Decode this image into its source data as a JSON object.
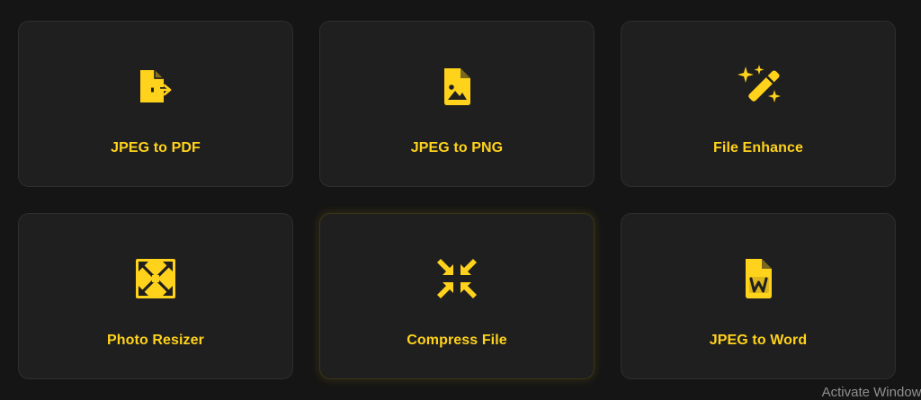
{
  "tools": [
    {
      "label": "JPEG to PDF",
      "icon": "file-export-icon"
    },
    {
      "label": "JPEG to PNG",
      "icon": "file-image-icon"
    },
    {
      "label": "File Enhance",
      "icon": "magic-wand-icon"
    },
    {
      "label": "Photo Resizer",
      "icon": "expand-arrows-icon"
    },
    {
      "label": "Compress File",
      "icon": "compress-arrows-icon"
    },
    {
      "label": "JPEG to Word",
      "icon": "file-word-icon"
    }
  ],
  "watermark": "Activate Windows",
  "colors": {
    "background": "#151515",
    "card": "#1f1f1f",
    "accent": "#ffd21c",
    "icon_cutout": "#1f1f1f"
  }
}
